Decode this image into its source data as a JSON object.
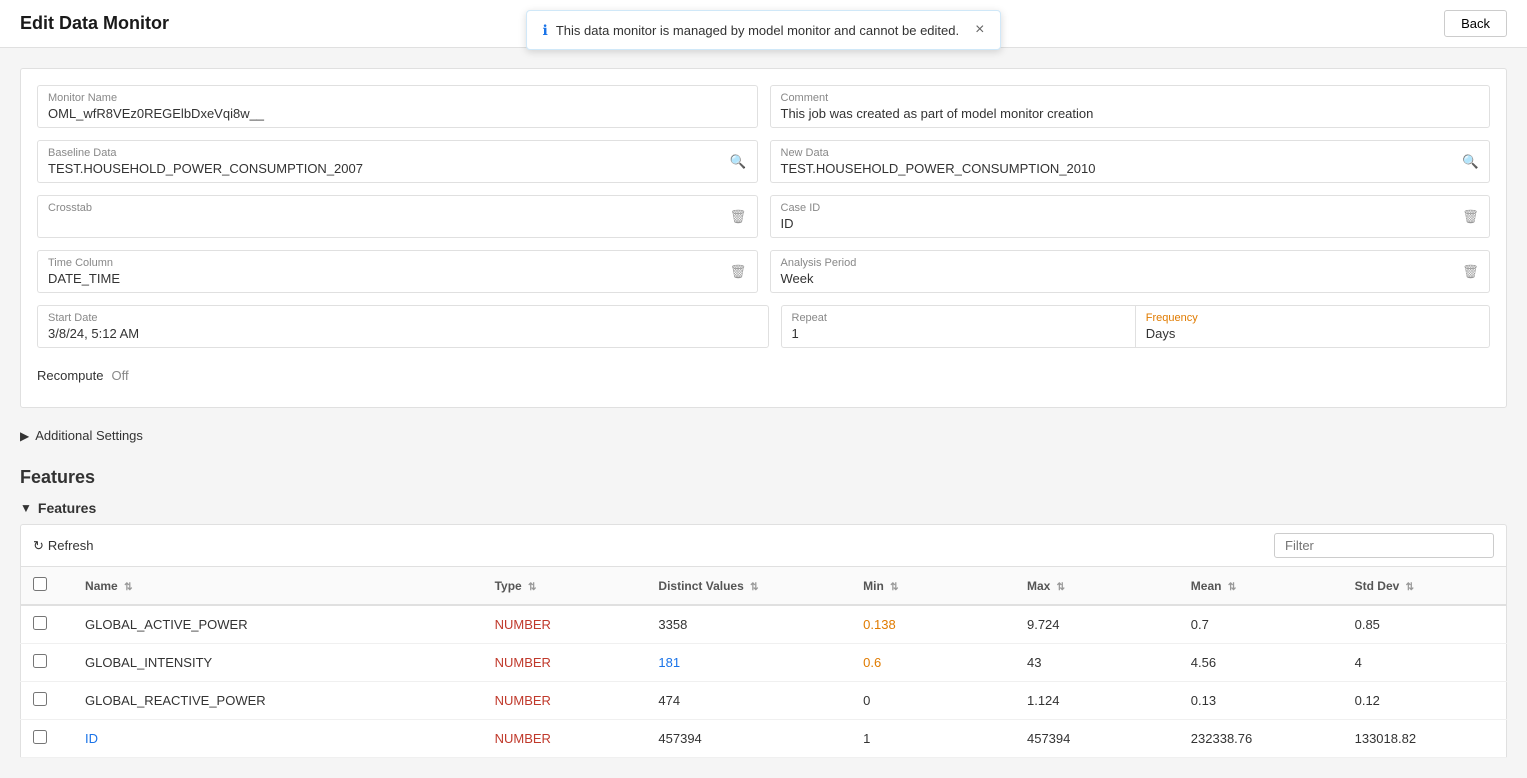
{
  "header": {
    "title": "Edit Data Monitor",
    "back_button": "Back"
  },
  "notification": {
    "text": "This data monitor is managed by model monitor and cannot be edited.",
    "close": "×"
  },
  "form": {
    "monitor_name": {
      "label": "Monitor Name",
      "value": "OML_wfR8VEz0REGElbDxeVqi8w__"
    },
    "comment": {
      "label": "Comment",
      "value": "This job was created as part of model monitor creation"
    },
    "baseline_data": {
      "label": "Baseline Data",
      "value": "TEST.HOUSEHOLD_POWER_CONSUMPTION_2007"
    },
    "new_data": {
      "label": "New Data",
      "value": "TEST.HOUSEHOLD_POWER_CONSUMPTION_2010"
    },
    "crosstab": {
      "label": "Crosstab",
      "value": ""
    },
    "case_id": {
      "label": "Case ID",
      "value": "ID"
    },
    "time_column": {
      "label": "Time Column",
      "value": "DATE_TIME"
    },
    "analysis_period": {
      "label": "Analysis Period",
      "value": "Week"
    },
    "start_date": {
      "label": "Start Date",
      "value": "3/8/24, 5:12 AM"
    },
    "repeat": {
      "label": "Repeat",
      "value": "1"
    },
    "frequency": {
      "label": "Frequency",
      "value": "Days"
    },
    "recompute": {
      "label": "Recompute",
      "value": "Off"
    }
  },
  "additional_settings": {
    "label": "Additional Settings"
  },
  "features": {
    "heading": "Features",
    "subheading": "Features",
    "refresh_label": "Refresh",
    "filter_placeholder": "Filter"
  },
  "table": {
    "columns": [
      {
        "key": "checkbox",
        "label": ""
      },
      {
        "key": "name",
        "label": "Name"
      },
      {
        "key": "type",
        "label": "Type"
      },
      {
        "key": "distinct",
        "label": "Distinct Values"
      },
      {
        "key": "min",
        "label": "Min"
      },
      {
        "key": "max",
        "label": "Max"
      },
      {
        "key": "mean",
        "label": "Mean"
      },
      {
        "key": "stddev",
        "label": "Std Dev"
      }
    ],
    "rows": [
      {
        "name": "GLOBAL_ACTIVE_POWER",
        "type": "NUMBER",
        "distinct": "3358",
        "min": "0.138",
        "max": "9.724",
        "mean": "0.7",
        "stddev": "0.85",
        "min_highlight": true,
        "distinct_highlight": false
      },
      {
        "name": "GLOBAL_INTENSITY",
        "type": "NUMBER",
        "distinct": "181",
        "min": "0.6",
        "max": "43",
        "mean": "4.56",
        "stddev": "4",
        "min_highlight": true,
        "distinct_highlight": true
      },
      {
        "name": "GLOBAL_REACTIVE_POWER",
        "type": "NUMBER",
        "distinct": "474",
        "min": "0",
        "max": "1.124",
        "mean": "0.13",
        "stddev": "0.12",
        "min_highlight": false,
        "distinct_highlight": false
      },
      {
        "name": "ID",
        "type": "NUMBER",
        "distinct": "457394",
        "min": "1",
        "max": "457394",
        "mean": "232338.76",
        "stddev": "133018.82",
        "min_highlight": false,
        "distinct_highlight": false,
        "name_link": true
      }
    ]
  }
}
